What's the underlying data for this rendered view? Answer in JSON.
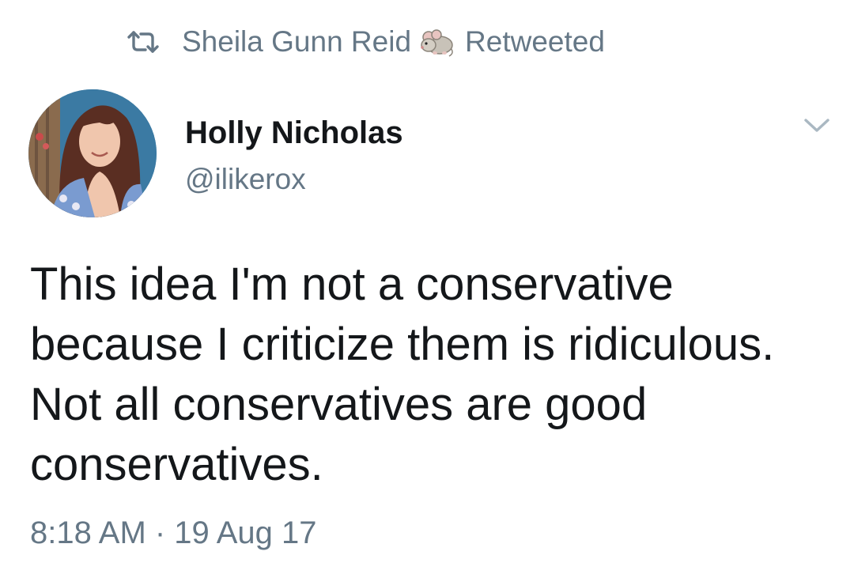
{
  "retweet": {
    "icon": "retweet-icon",
    "retweeter": "Sheila Gunn Reid",
    "emoji": "mouse-emoji",
    "label": "Retweeted"
  },
  "author": {
    "display_name": "Holly Nicholas",
    "handle": "@ilikerox",
    "avatar": "profile-photo"
  },
  "tweet": {
    "text": "This idea I'm not a conservative because I criticize them is ridiculous. Not all conservatives are good conservatives.",
    "timestamp": "8:18 AM · 19 Aug 17"
  },
  "menu": {
    "icon": "chevron-down-icon"
  },
  "colors": {
    "text_primary": "#14171a",
    "text_secondary": "#657786",
    "background": "#ffffff"
  }
}
